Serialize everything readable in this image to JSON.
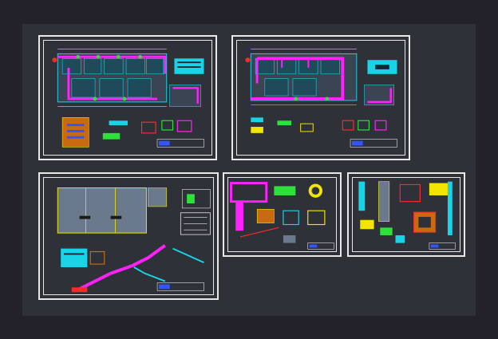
{
  "colors": {
    "background": "#232129",
    "viewport": "#2f3139",
    "sheet_border": "#e8e8e8",
    "pipe_magenta": "#ff22ff",
    "cad_cyan": "#19d3e6",
    "cad_yellow": "#f2e600",
    "cad_green": "#2ee03a",
    "cad_red": "#ff2a2a",
    "cad_blue": "#3355ff",
    "cad_slate": "#6a7a8c"
  },
  "sheets": [
    {
      "id": "sheet-1",
      "description_icon": "floor-plan-sheet-icon"
    },
    {
      "id": "sheet-2",
      "description_icon": "floor-plan-sheet-icon"
    },
    {
      "id": "sheet-3",
      "description_icon": "roof-plan-sheet-icon"
    },
    {
      "id": "sheet-4",
      "description_icon": "detail-sheet-icon"
    },
    {
      "id": "sheet-5",
      "description_icon": "detail-sheet-icon"
    }
  ]
}
